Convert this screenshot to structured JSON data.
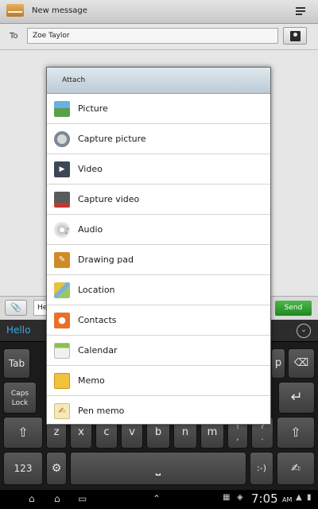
{
  "app": {
    "title": "New message"
  },
  "compose": {
    "to_label": "To",
    "to_value": "Zoe Taylor",
    "message_value": "He",
    "send_label": "Send",
    "attach_glyph": "📎"
  },
  "dialog": {
    "title": "Attach",
    "options": [
      {
        "label": "Picture",
        "icon": "picture-icon",
        "color": "#5aa04a"
      },
      {
        "label": "Capture picture",
        "icon": "camera-icon",
        "color": "#7d8896"
      },
      {
        "label": "Video",
        "icon": "video-icon",
        "color": "#3b4656"
      },
      {
        "label": "Capture video",
        "icon": "camcorder-icon",
        "color": "#c0392b"
      },
      {
        "label": "Audio",
        "icon": "audio-icon",
        "color": "#a070c8"
      },
      {
        "label": "Drawing pad",
        "icon": "drawing-pad-icon",
        "color": "#d08a28"
      },
      {
        "label": "Location",
        "icon": "location-icon",
        "color": "#e8c23a"
      },
      {
        "label": "Contacts",
        "icon": "contacts-icon",
        "color": "#e8702a"
      },
      {
        "label": "Calendar",
        "icon": "calendar-icon",
        "color": "#8cc04a"
      },
      {
        "label": "Memo",
        "icon": "memo-icon",
        "color": "#f2c23c"
      },
      {
        "label": "Pen memo",
        "icon": "pen-memo-icon",
        "color": "#f5e9b8"
      }
    ]
  },
  "keyboard": {
    "suggestion": "Hello",
    "keys": {
      "tab": "Tab",
      "p": "p",
      "backspace": "⌫",
      "caps_lock": "Caps\nLock",
      "enter": "↵",
      "shift_left": "⇧",
      "shift_right": "⇧",
      "z": "z",
      "x": "x",
      "c": "c",
      "v": "v",
      "b": "b",
      "n": "n",
      "m": "m",
      "excl": "!\n,",
      "quest": "?\n.",
      "numbers": "123",
      "settings": "⚙",
      "space": "⎵",
      "smiley": ":-)",
      "handwriting": "✍"
    }
  },
  "status": {
    "time": "7:05",
    "ampm": "AM"
  }
}
